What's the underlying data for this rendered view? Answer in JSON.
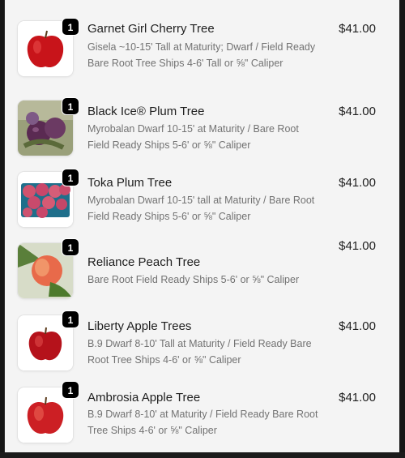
{
  "items": [
    {
      "name": "Garnet Girl Cherry Tree",
      "description": "Gisela ~10-15' Tall at Maturity; Dwarf / Field Ready Bare Root Tree Ships 4-6' Tall or ⅝\" Caliper",
      "price": "$41.00",
      "quantity": "1",
      "icon": "apple-fruit-icon"
    },
    {
      "name": "Black Ice® Plum Tree",
      "description": "Myrobalan Dwarf 10-15' at Maturity / Bare Root Field Ready Ships 5-6' or ⅝\" Caliper",
      "price": "$41.00",
      "quantity": "1",
      "icon": "plum-fruit-icon"
    },
    {
      "name": "Toka Plum Tree",
      "description": "Myrobalan Dwarf 10-15' tall at Maturity / Bare Root Field Ready Ships 5-6' or ⅝\" Caliper",
      "price": "$41.00",
      "quantity": "1",
      "icon": "plum-basket-icon"
    },
    {
      "name": "Reliance Peach Tree",
      "description": "Bare Root Field Ready Ships 5-6' or ⅝\" Caliper",
      "price": "$41.00",
      "quantity": "1",
      "icon": "peach-fruit-icon"
    },
    {
      "name": "Liberty Apple Trees",
      "description": "B.9 Dwarf 8-10' Tall at Maturity / Field Ready Bare Root Tree Ships 4-6' or ⅝\" Caliper",
      "price": "$41.00",
      "quantity": "1",
      "icon": "apple-fruit-icon"
    },
    {
      "name": "Ambrosia Apple Tree",
      "description": "B.9 Dwarf 8-10' at Maturity / Field Ready Bare Root Tree Ships 4-6' or ⅝\" Caliper",
      "price": "$41.00",
      "quantity": "1",
      "icon": "apple-fruit-icon"
    }
  ]
}
